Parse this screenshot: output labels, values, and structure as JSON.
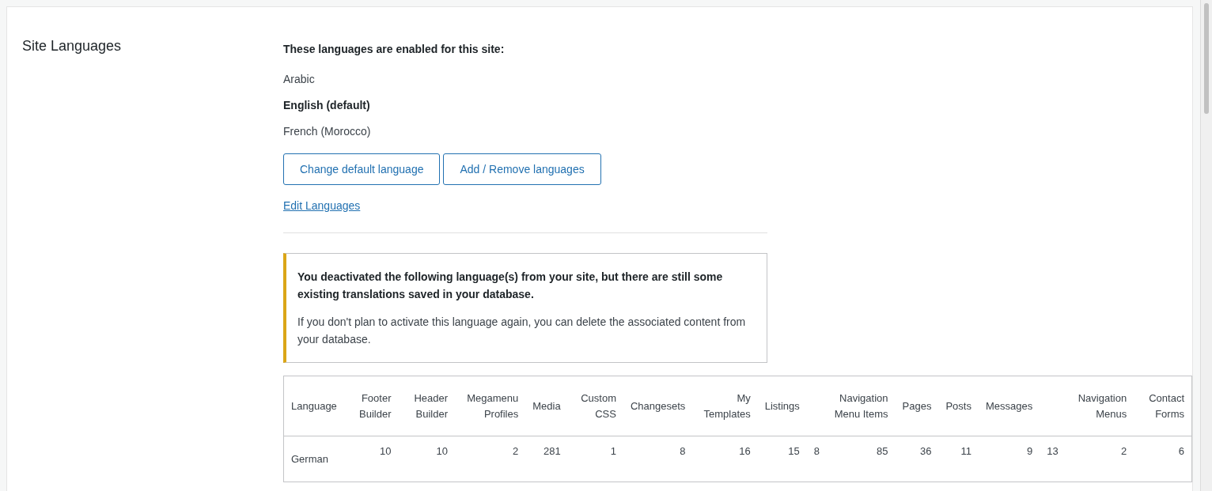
{
  "section_title": "Site Languages",
  "enabled_heading": "These languages are enabled for this site:",
  "languages": [
    {
      "name": "Arabic",
      "default": false
    },
    {
      "name": "English (default)",
      "default": true
    },
    {
      "name": "French (Morocco)",
      "default": false
    }
  ],
  "buttons": [
    "Change default language",
    "Add / Remove languages"
  ],
  "edit_link": "Edit Languages",
  "notice": {
    "title": "You deactivated the following language(s) from your site, but there are still some existing translations saved in your database.",
    "body": "If you don't plan to activate this language again, you can delete the associated content from your database."
  },
  "table": {
    "columns": [
      {
        "label": "Language"
      },
      {
        "label": "Footer Builder"
      },
      {
        "label": "Header Builder"
      },
      {
        "label": "Megamenu Profiles"
      },
      {
        "label": "Media"
      },
      {
        "label": "Custom CSS"
      },
      {
        "label": "Changesets"
      },
      {
        "label": "My Templates"
      },
      {
        "label": "Listings"
      },
      {},
      {
        "label": "Navigation Menu Items"
      },
      {
        "label": "Pages"
      },
      {
        "label": "Posts"
      },
      {
        "label": "Messages"
      },
      {},
      {
        "label": "Navigation Menus"
      },
      {
        "label": "Contact Forms"
      }
    ],
    "rows": [
      [
        "German",
        "10",
        "10",
        "2",
        "281",
        "1",
        "8",
        "16",
        "15",
        "8",
        "85",
        "36",
        "11",
        "9",
        "13",
        "2",
        "6"
      ]
    ]
  }
}
